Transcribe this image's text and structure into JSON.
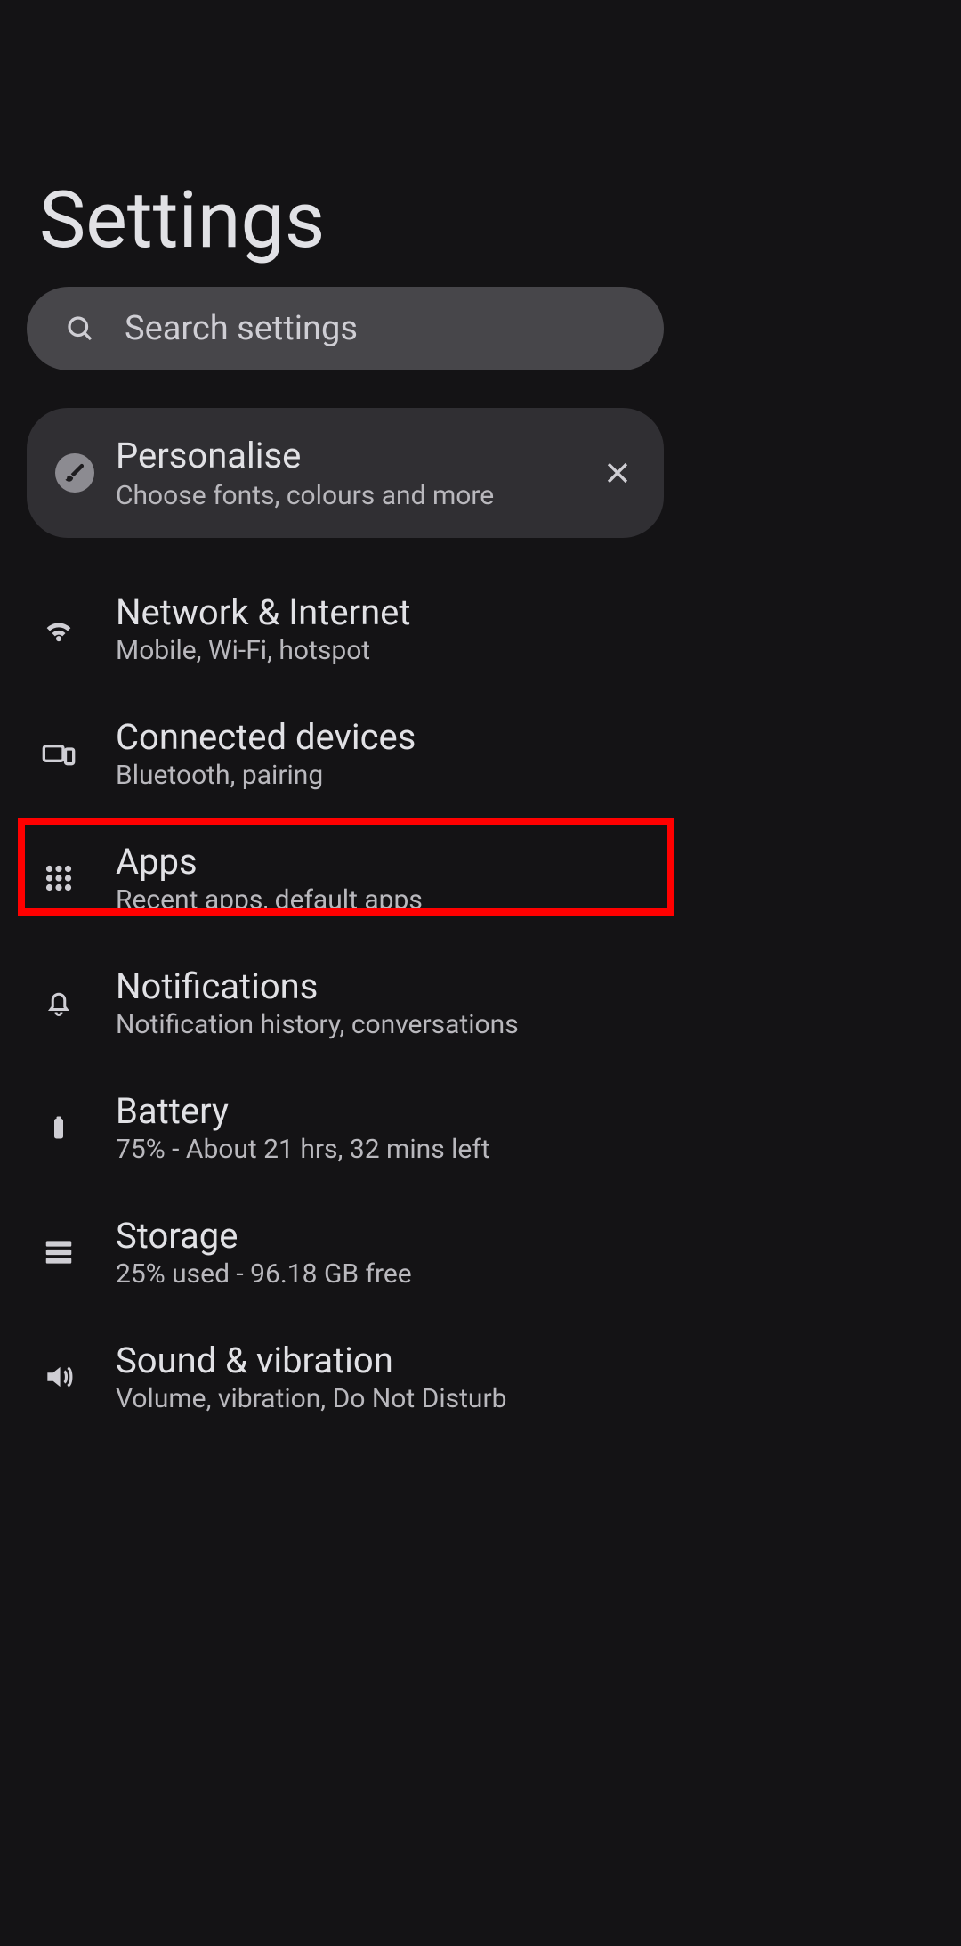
{
  "header": {
    "title": "Settings"
  },
  "search": {
    "placeholder": "Search settings"
  },
  "promo": {
    "title": "Personalise",
    "subtitle": "Choose fonts, colours and more"
  },
  "items": [
    {
      "title": "Network & Internet",
      "subtitle": "Mobile, Wi-Fi, hotspot",
      "icon": "wifi"
    },
    {
      "title": "Connected devices",
      "subtitle": "Bluetooth, pairing",
      "icon": "devices"
    },
    {
      "title": "Apps",
      "subtitle": "Recent apps, default apps",
      "icon": "apps"
    },
    {
      "title": "Notifications",
      "subtitle": "Notification history, conversations",
      "icon": "bell"
    },
    {
      "title": "Battery",
      "subtitle": "75% - About 21 hrs, 32 mins left",
      "icon": "battery"
    },
    {
      "title": "Storage",
      "subtitle": "25% used - 96.18 GB free",
      "icon": "storage"
    },
    {
      "title": "Sound & vibration",
      "subtitle": "Volume, vibration, Do Not Disturb",
      "icon": "volume"
    }
  ],
  "highlighted_index": 2
}
